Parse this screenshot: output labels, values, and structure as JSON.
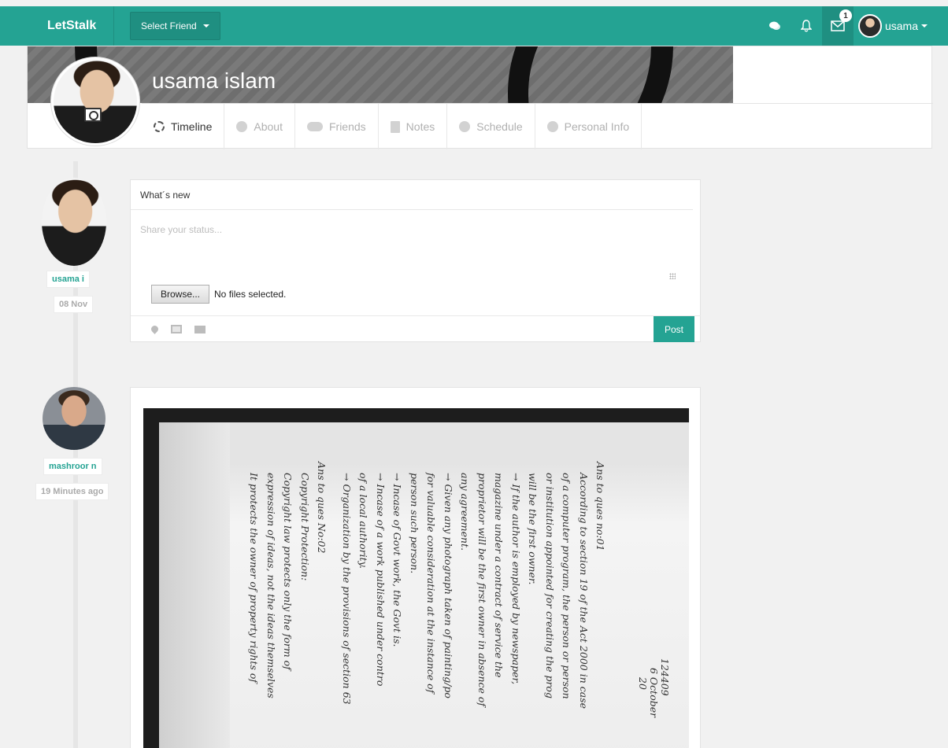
{
  "navbar": {
    "brand": "LetStalk",
    "select_friend": "Select Friend",
    "messages_badge": "1",
    "username": "usama"
  },
  "profile": {
    "name": "usama islam",
    "tabs": [
      {
        "label": "Timeline",
        "active": true
      },
      {
        "label": "About"
      },
      {
        "label": "Friends"
      },
      {
        "label": "Notes"
      },
      {
        "label": "Schedule"
      },
      {
        "label": "Personal Info"
      }
    ]
  },
  "status_box": {
    "user_name": "usama i",
    "date": "08 Nov",
    "title": "What´s new",
    "placeholder": "Share your status...",
    "browse_label": "Browse...",
    "file_status": "No files selected.",
    "post_label": "Post"
  },
  "post": {
    "user_name": "mashroor n",
    "time": "19 Minutes ago",
    "note_lines": [
      "Ans to ques no:01",
      "According to section 19 of the Act 2000 in case",
      "of a computer program, the person or person",
      "or institution appointed for creating the prog",
      "will be the first owner.",
      "→ If the author is employed by newspaper,",
      "magazine under a contract of service the",
      "proprietor will be the first owner in absence of",
      "any agreement.",
      "→ Given any photograph taken of painting/po",
      "for valuable consideration at the instance of",
      "person such person.",
      "→ Incase of Govt work, the Govt is.",
      "→ Incase of a work published under contro",
      "of a local authority.",
      "→ Organization by the provisions of section 63",
      "Ans to ques No:02",
      "Copyright Protection:",
      "Copyright law protects only the form of",
      "expression of ideas, not the ideas themselves",
      "It protects the owner of property rights of"
    ],
    "corner_text": [
      "124409",
      "6 October",
      "20"
    ]
  }
}
